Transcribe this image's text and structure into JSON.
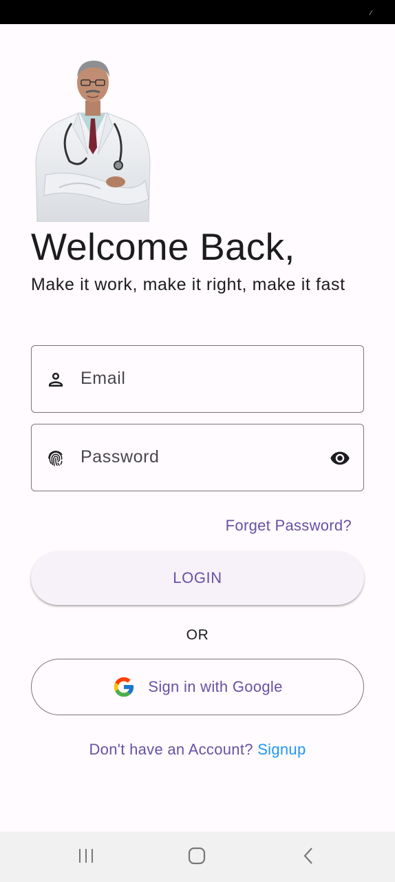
{
  "heading": {
    "title": "Welcome Back,",
    "subtitle": "Make it work, make it right, make it fast"
  },
  "form": {
    "email": {
      "placeholder": "Email",
      "value": "",
      "icon": "person-icon"
    },
    "password": {
      "placeholder": "Password",
      "value": "",
      "icon": "fingerprint-icon",
      "toggle_icon": "eye-icon"
    },
    "forget_label": "Forget Password?",
    "login_label": "LOGIN"
  },
  "divider_label": "OR",
  "google": {
    "label": "Sign in with Google",
    "icon": "google-logo-icon"
  },
  "signup": {
    "question": "Don't have an Account? ",
    "link_label": "Signup"
  },
  "colors": {
    "accent": "#6750a4",
    "link": "#2196f3",
    "background": "#fffbfe",
    "outline": "#79747e"
  }
}
